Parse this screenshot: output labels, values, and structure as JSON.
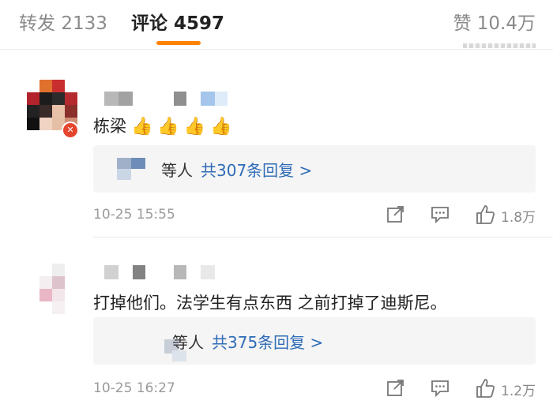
{
  "tabs": {
    "repost_label": "转发",
    "repost_count": "2133",
    "comment_label": "评论",
    "comment_count": "4597",
    "like_label": "赞",
    "like_count": "10.4万"
  },
  "accent_color": "#ff8200",
  "link_color": "#2e6bb6",
  "comments": [
    {
      "text": "栋梁",
      "emoji": "👍",
      "reply_prefix": "等人",
      "reply_link": "共307条回复 >",
      "time": "10-25 15:55",
      "likes": "1.8万"
    },
    {
      "text": "打掉他们。法学生有点东西 之前打掉了迪斯尼。",
      "reply_prefix": "等人",
      "reply_link": "共375条回复 >",
      "time": "10-25 16:27",
      "likes": "1.2万"
    }
  ],
  "icons": [
    "share-icon",
    "comment-icon",
    "like-icon",
    "thumbs-up-emoji"
  ]
}
